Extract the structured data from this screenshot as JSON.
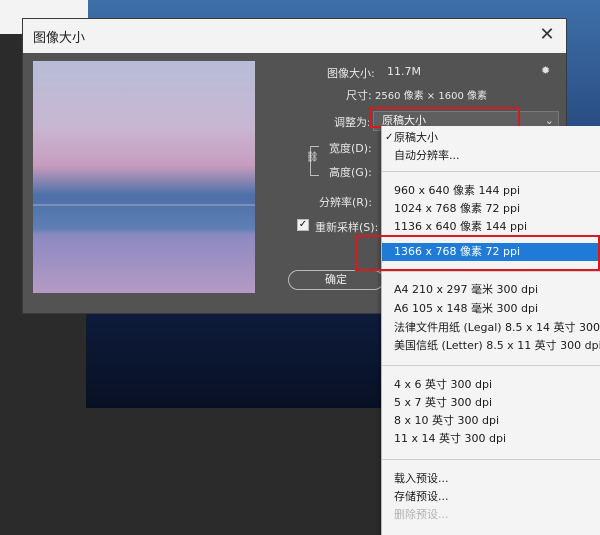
{
  "dialog": {
    "title": "图像大小",
    "image_size_label": "图像大小:",
    "image_size_value": "11.7M",
    "dimensions_label": "尺寸:",
    "dimensions_value": "2560 像素 × 1600 像素",
    "fit_to_label": "调整为:",
    "fit_to_value": "原稿大小",
    "width_label": "宽度(D):",
    "height_label": "高度(G):",
    "resolution_label": "分辨率(R):",
    "resample_label": "重新采样(S):",
    "resample_checked": "✓",
    "ok_label": "确定"
  },
  "dropdown": {
    "items": [
      {
        "label": "原稿大小",
        "checked": "✓"
      },
      {
        "label": "自动分辨率..."
      },
      {
        "label": "960 x 640 像素 144 ppi"
      },
      {
        "label": "1024 x 768 像素 72 ppi"
      },
      {
        "label": "1136 x 640 像素 144 ppi"
      },
      {
        "label": "1366 x 768 像素 72 ppi",
        "selected": true
      },
      {
        "label": "A4 210 x 297 毫米 300 dpi"
      },
      {
        "label": "A6 105 x 148 毫米 300 dpi"
      },
      {
        "label": "法律文件用纸 (Legal) 8.5 x 14 英寸 300 dpi"
      },
      {
        "label": "美国信纸 (Letter) 8.5 x 11 英寸 300 dpi"
      },
      {
        "label": "4 x 6 英寸 300 dpi"
      },
      {
        "label": "5 x 7 英寸 300 dpi"
      },
      {
        "label": "8 x 10 英寸 300 dpi"
      },
      {
        "label": "11 x 14 英寸 300 dpi"
      },
      {
        "label": "载入预设..."
      },
      {
        "label": "存储预设..."
      },
      {
        "label": "删除预设...",
        "disabled": true
      }
    ]
  },
  "colors": {
    "dialog_bg": "#535353",
    "titlebar_bg": "#f3f3f3",
    "menu_bg": "#f4f4f4",
    "menu_selected": "#1f7bd6",
    "highlight": "#d51b1b"
  },
  "icons": [
    "close-icon",
    "gear-icon",
    "link-icon",
    "chevron-down-icon",
    "checkmark-icon"
  ]
}
